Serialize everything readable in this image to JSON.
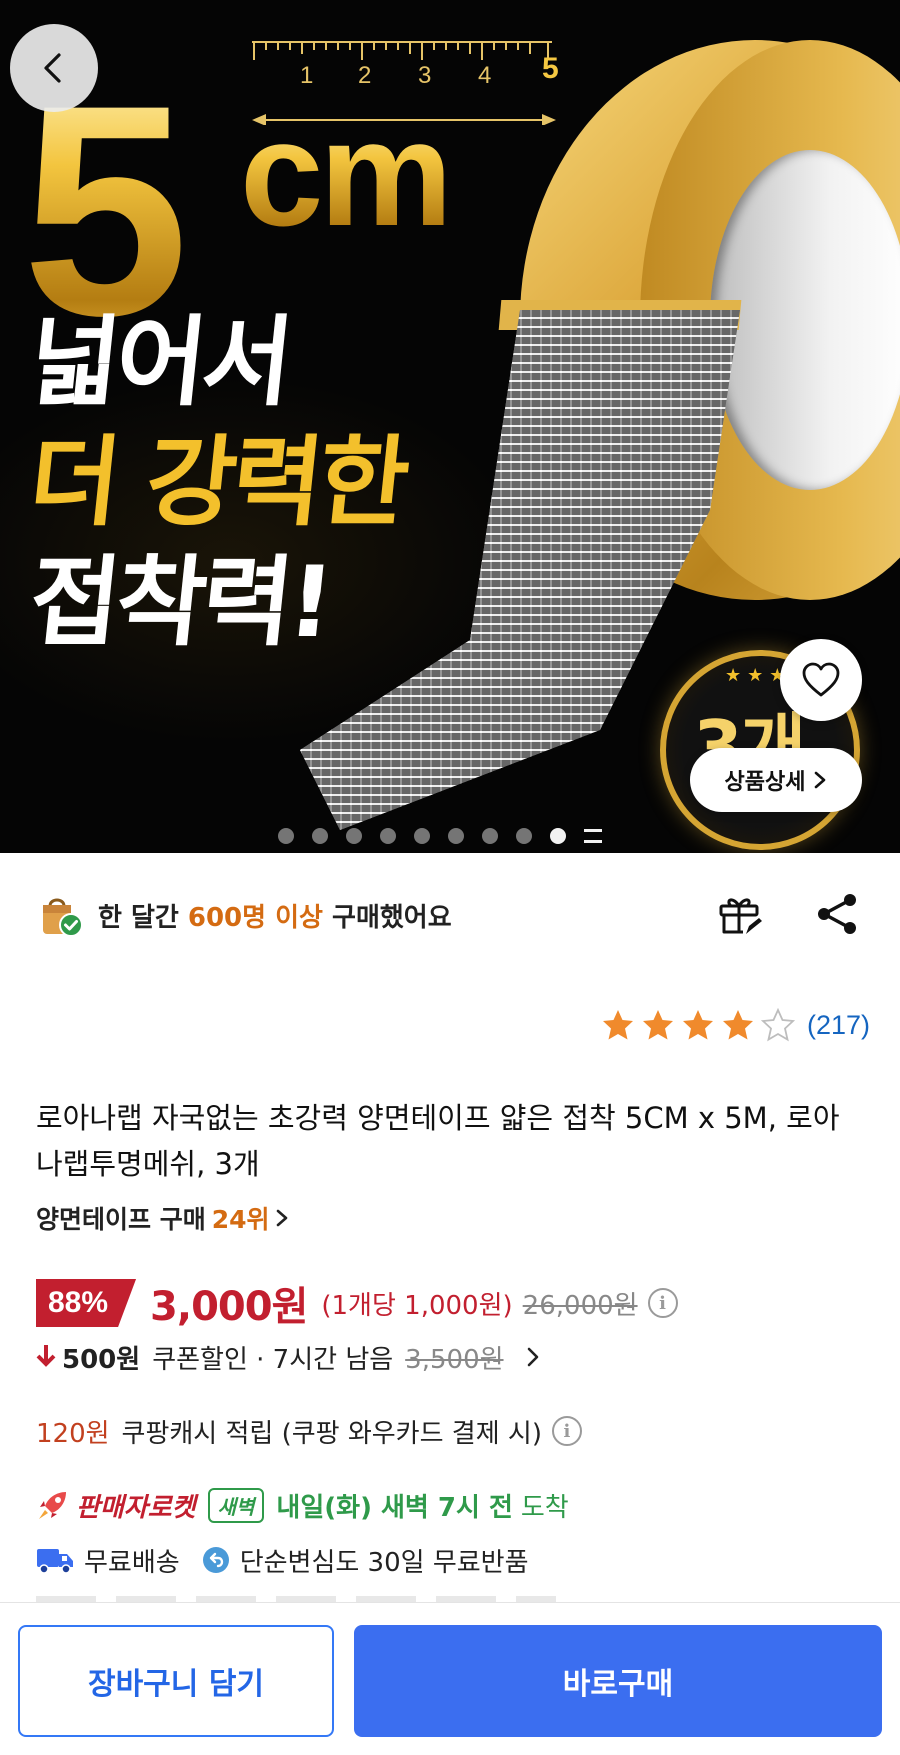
{
  "hero": {
    "ruler_numbers": [
      "1",
      "2",
      "3",
      "4",
      "5"
    ],
    "big_number": "5",
    "big_unit": "cm",
    "slogan_line1": "넓어서",
    "slogan_line2": "더 강력한",
    "slogan_line3": "접착력!",
    "badge_stars": "★★★",
    "badge_text": "3개",
    "detail_button_label": "상품상세",
    "carousel_dot_count": 9,
    "carousel_active_index": 8
  },
  "social_proof": {
    "prefix": "한 달간 ",
    "highlight": "600명 이상",
    "suffix": " 구매했어요"
  },
  "rating": {
    "stars": 4,
    "max_stars": 5,
    "count": "(217)"
  },
  "product": {
    "title": "로아나랩 자국없는 초강력 양면테이프 얇은 접착 5CM x 5M, 로아나랩투명메쉬, 3개",
    "rank_label": "양면테이프 구매 ",
    "rank_value": "24위"
  },
  "price": {
    "discount": "88%",
    "sale_price": "3,000원",
    "unit_price": "(1개당 1,000원)",
    "original_price": "26,000원"
  },
  "coupon": {
    "amount": "500원",
    "text": "쿠폰할인 · 7시간 남음",
    "struck_price": "3,500원"
  },
  "cashback": {
    "amount": "120원",
    "text": "쿠팡캐시 적립 (쿠팡 와우카드 결제 시)"
  },
  "delivery": {
    "seller_label": "판매자로켓",
    "dawn_badge": "새벽",
    "arrival": "내일(화) 새벽 7시 전",
    "arrival_suffix": "도착"
  },
  "shipping": {
    "free_shipping": "무료배송",
    "free_return": "단순변심도 30일 무료반품"
  },
  "bottom_bar": {
    "cart_label": "장바구니 담기",
    "buy_label": "바로구매"
  },
  "colors": {
    "accent_blue": "#3b6ef0",
    "price_red": "#c21f2f",
    "highlight_orange": "#d46b12",
    "delivery_green": "#2f9a4a",
    "star_orange": "#f08a2c"
  }
}
